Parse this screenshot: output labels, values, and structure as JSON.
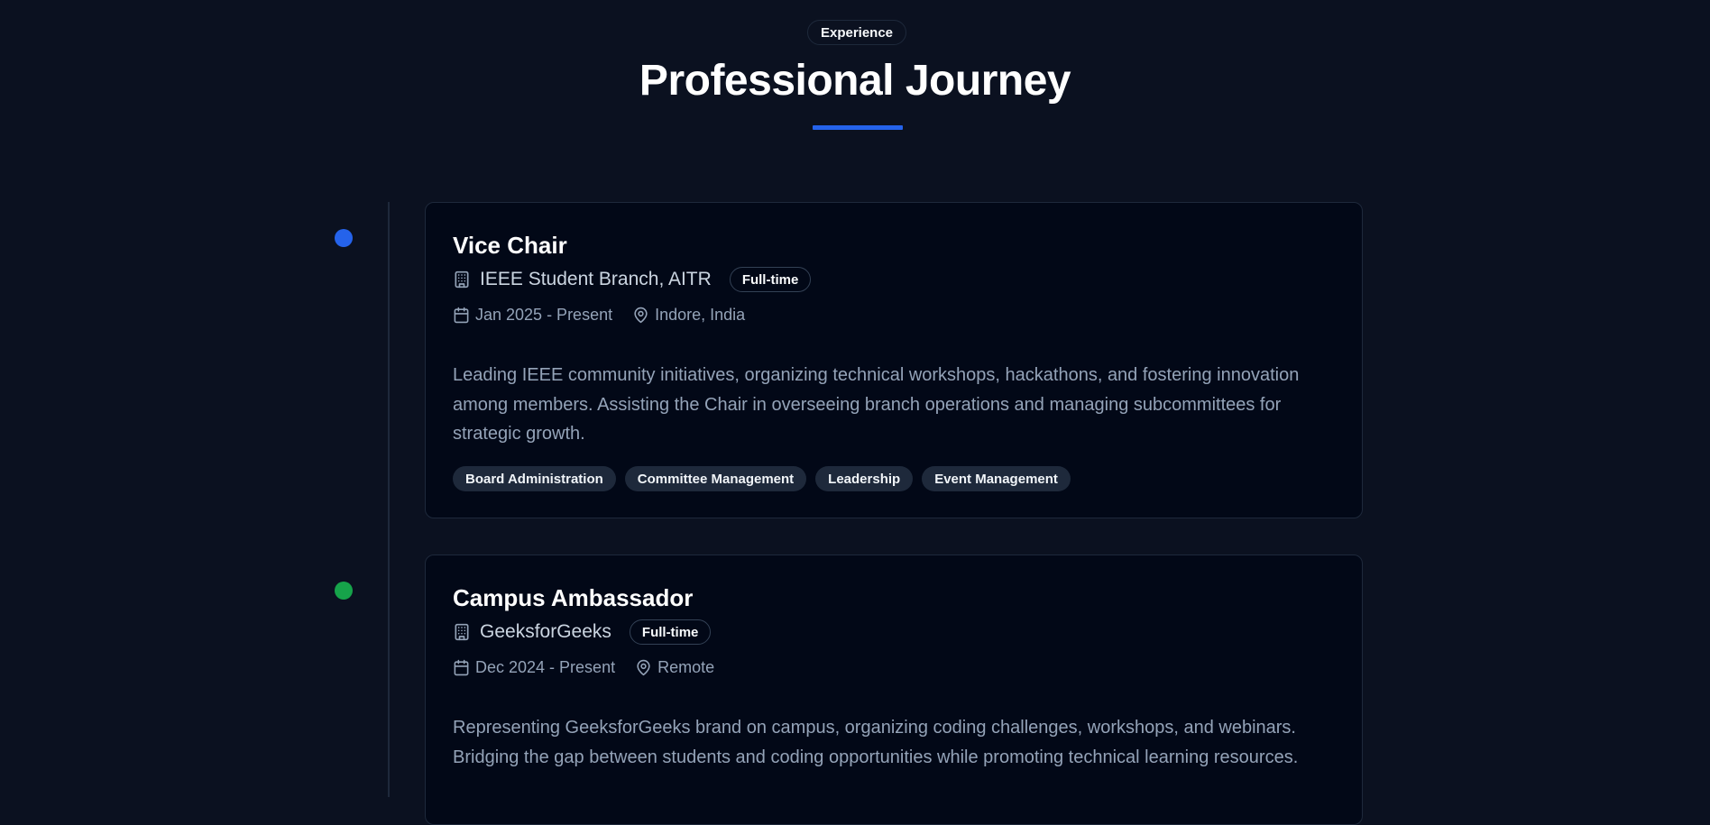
{
  "header": {
    "badge": "Experience",
    "title": "Professional Journey",
    "accent_color": "#2563eb"
  },
  "experiences": [
    {
      "role": "Vice Chair",
      "organization": "IEEE Student Branch, AITR",
      "type": "Full-time",
      "dates": "Jan 2025 - Present",
      "location": "Indore, India",
      "description": "Leading IEEE community initiatives, organizing technical workshops, hackathons, and fostering innovation among members. Assisting the Chair in overseeing branch operations and managing subcommittees for strategic growth.",
      "skills": [
        "Board Administration",
        "Committee Management",
        "Leadership",
        "Event Management"
      ],
      "dot_color": "#2563eb"
    },
    {
      "role": "Campus Ambassador",
      "organization": "GeeksforGeeks",
      "type": "Full-time",
      "dates": "Dec 2024 - Present",
      "location": "Remote",
      "description": "Representing GeeksforGeeks brand on campus, organizing coding challenges, workshops, and webinars. Bridging the gap between students and coding opportunities while promoting technical learning resources.",
      "dot_color": "#16a34a"
    }
  ],
  "icons": {
    "organization": "building-icon",
    "date": "calendar-icon",
    "location": "map-pin-icon"
  }
}
